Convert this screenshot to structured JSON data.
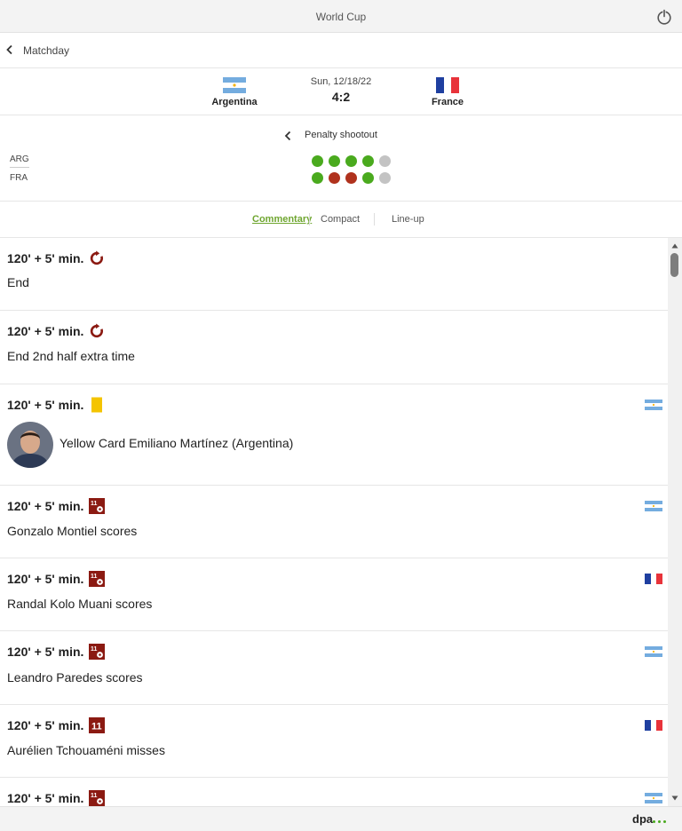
{
  "window": {
    "title": "World Cup"
  },
  "nav": {
    "back_label": "Matchday"
  },
  "match": {
    "home": {
      "name": "Argentina",
      "flag": "argentina-flag"
    },
    "away": {
      "name": "France",
      "flag": "france-flag"
    },
    "date": "Sun, 12/18/22",
    "score": "4:2"
  },
  "penalty": {
    "title": "Penalty shootout",
    "rows": [
      {
        "team": "ARG",
        "shots": [
          "scored",
          "scored",
          "scored",
          "scored",
          "not-taken"
        ]
      },
      {
        "team": "FRA",
        "shots": [
          "scored",
          "missed",
          "missed",
          "scored",
          "not-taken"
        ]
      }
    ]
  },
  "tabs": {
    "commentary": "Commentary",
    "compact": "Compact",
    "lineup": "Line-up",
    "active": "commentary"
  },
  "events": [
    {
      "time": "120' + 5' min.",
      "icon": "whistle-end-icon",
      "flag": "",
      "text": "End"
    },
    {
      "time": "120' + 5' min.",
      "icon": "whistle-end-icon",
      "flag": "",
      "text": "End 2nd half extra time"
    },
    {
      "time": "120' + 5' min.",
      "icon": "yellow-card-icon",
      "flag": "argentina-flag",
      "text": "Yellow Card Emiliano Martínez (Argentina)",
      "avatar": "player-avatar"
    },
    {
      "time": "120' + 5' min.",
      "icon": "penalty-scored-icon",
      "flag": "argentina-flag",
      "text": "Gonzalo Montiel scores"
    },
    {
      "time": "120' + 5' min.",
      "icon": "penalty-scored-icon",
      "flag": "france-flag",
      "text": "Randal Kolo Muani scores"
    },
    {
      "time": "120' + 5' min.",
      "icon": "penalty-scored-icon",
      "flag": "argentina-flag",
      "text": "Leandro Paredes scores"
    },
    {
      "time": "120' + 5' min.",
      "icon": "penalty-missed-icon",
      "flag": "france-flag",
      "text": "Aurélien Tchouaméni misses"
    },
    {
      "time": "120' + 5' min.",
      "icon": "penalty-scored-icon",
      "flag": "argentina-flag",
      "text": ""
    }
  ],
  "footer": {
    "brand": "dpa"
  },
  "colors": {
    "accent": "#6fa630",
    "dot_scored": "#4aaa1e",
    "dot_missed": "#b0321d",
    "dot_pending": "#c3c3c3",
    "event_icon": "#8b1a12",
    "yellow_card": "#f4c400"
  }
}
